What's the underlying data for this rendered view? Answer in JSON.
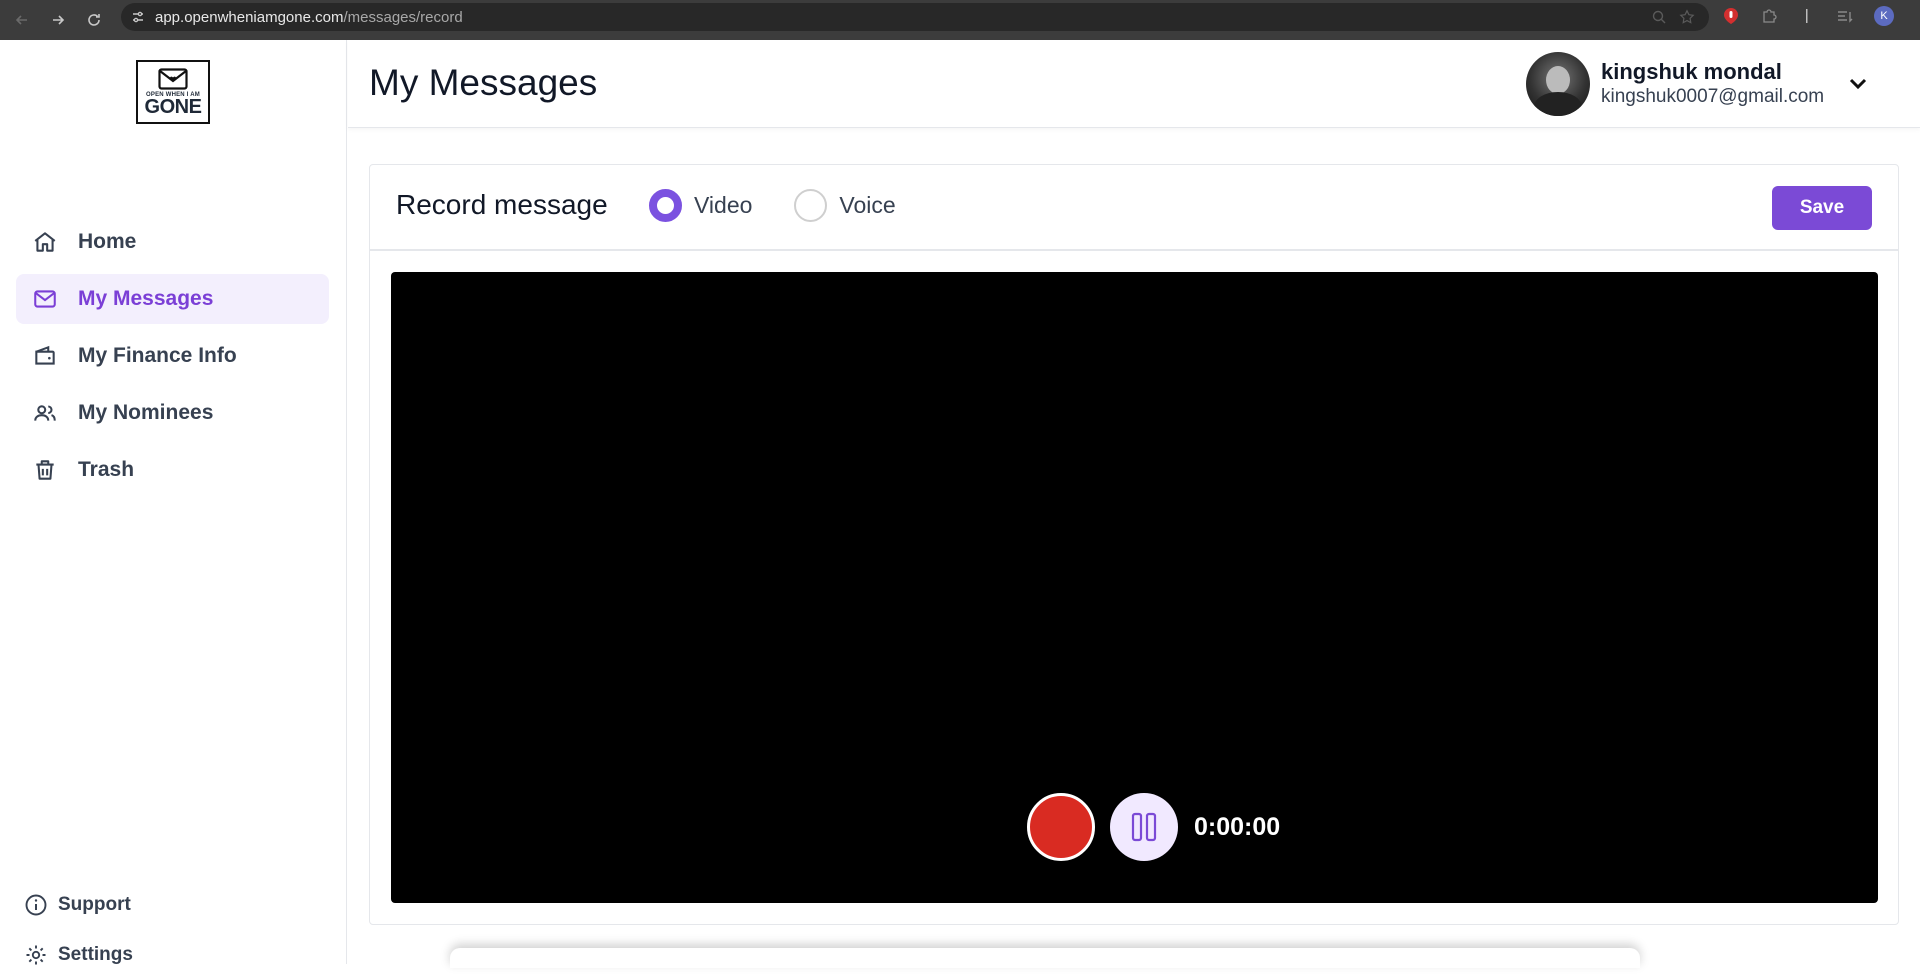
{
  "browser": {
    "url_host": "app.openwheniamgone.com",
    "url_path": "/messages/record",
    "profile_initial": "K"
  },
  "logo": {
    "tagline": "OPEN WHEN I AM",
    "word": "GONE",
    "icon": "envelope-heart-icon"
  },
  "sidebar": {
    "items": [
      {
        "label": "Home",
        "icon": "home-icon"
      },
      {
        "label": "My Messages",
        "icon": "mail-icon",
        "active": true
      },
      {
        "label": "My Finance Info",
        "icon": "wallet-icon"
      },
      {
        "label": "My Nominees",
        "icon": "users-icon"
      },
      {
        "label": "Trash",
        "icon": "trash-icon"
      }
    ],
    "bottom": [
      {
        "label": "Support",
        "icon": "info-icon"
      },
      {
        "label": "Settings",
        "icon": "gear-icon"
      }
    ]
  },
  "header": {
    "title": "My Messages",
    "user_name": "kingshuk mondal",
    "user_email": "kingshuk0007@gmail.com"
  },
  "recorder": {
    "title": "Record message",
    "options": [
      {
        "label": "Video",
        "selected": true
      },
      {
        "label": "Voice",
        "selected": false
      }
    ],
    "save_label": "Save",
    "timer": "0:00:00"
  },
  "colors": {
    "accent": "#7b4ad6",
    "record": "#d92b22",
    "active_bg": "#f3effd"
  }
}
